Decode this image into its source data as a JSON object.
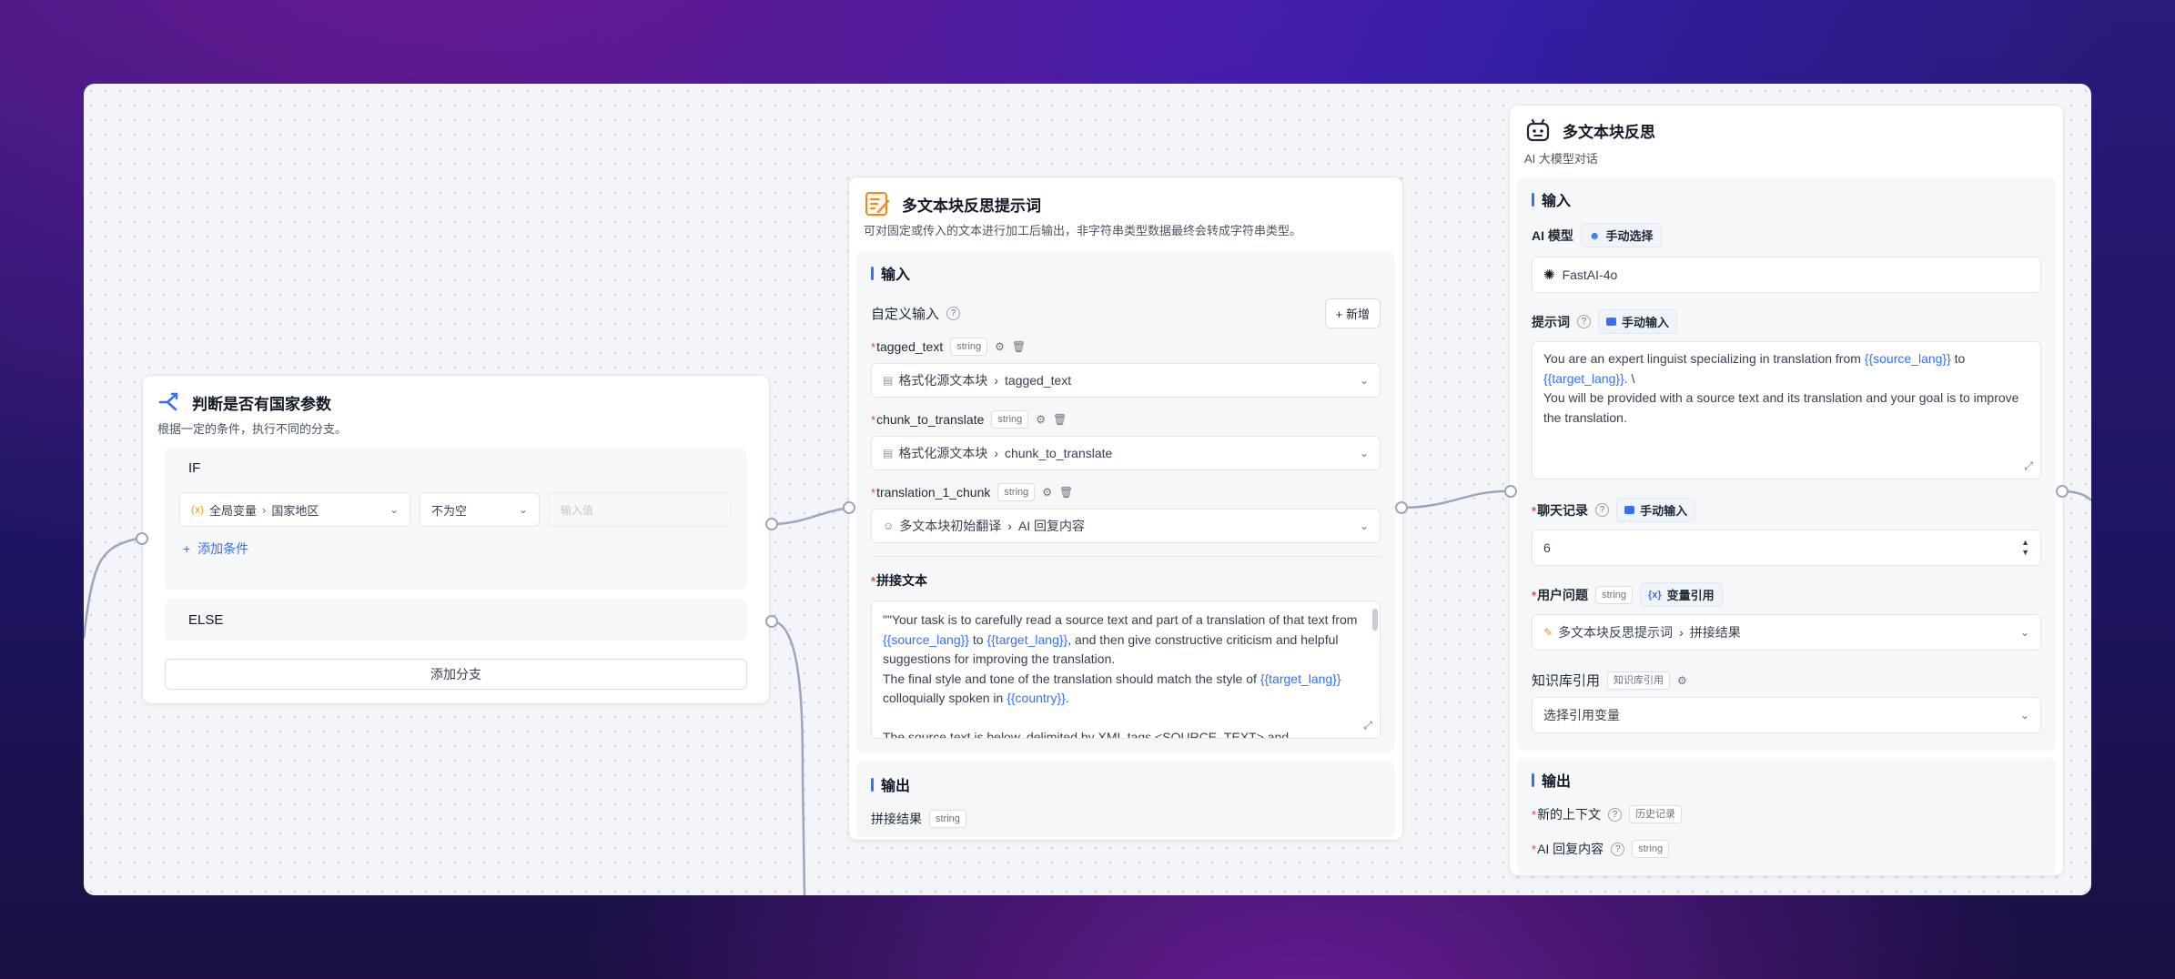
{
  "node_condition": {
    "title": "判断是否有国家参数",
    "description": "根据一定的条件，执行不同的分支。",
    "if_label": "IF",
    "variable_scope": "全局变量",
    "variable_name": "国家地区",
    "operator": "不为空",
    "value_placeholder": "输入值",
    "add_condition": "添加条件",
    "else_label": "ELSE",
    "add_branch": "添加分支"
  },
  "node_prompt": {
    "title": "多文本块反思提示词",
    "description": "可对固定或传入的文本进行加工后输出，非字符串类型数据最终会转成字符串类型。",
    "input_title": "输入",
    "custom_input_label": "自定义输入",
    "add_button": "+ 新增",
    "vars": [
      {
        "name": "tagged_text",
        "type": "string",
        "source": "格式化源文本块",
        "target": "tagged_text"
      },
      {
        "name": "chunk_to_translate",
        "type": "string",
        "source": "格式化源文本块",
        "target": "chunk_to_translate"
      },
      {
        "name": "translation_1_chunk",
        "type": "string",
        "source": "多文本块初始翻译",
        "target": "AI 回复内容"
      }
    ],
    "concat_label": "拼接文本",
    "concat_segments": [
      {
        "t": "\"\"Your task is to carefully read a source text and part of a translation of that text from "
      },
      {
        "t": "{{source_lang}}",
        "v": true
      },
      {
        "t": " to "
      },
      {
        "t": "{{target_lang}}",
        "v": true
      },
      {
        "t": ", and then give constructive criticism and helpful suggestions for improving the translation.\nThe final style and tone of the translation should match the style of "
      },
      {
        "t": "{{target_lang}}",
        "v": true
      },
      {
        "t": " colloquially spoken in "
      },
      {
        "t": "{{country}}",
        "v": true
      },
      {
        "t": ".\n\nThe source text is below, delimited by XML tags <SOURCE_TEXT> and"
      }
    ],
    "output_title": "输出",
    "output_name": "拼接结果",
    "output_type": "string"
  },
  "node_ai": {
    "title": "多文本块反思",
    "subtitle": "AI 大模型对话",
    "input_title": "输入",
    "model_label": "AI 模型",
    "model_mode": "手动选择",
    "model_value": "FastAI-4o",
    "prompt_label": "提示词",
    "prompt_mode": "手动输入",
    "prompt_segments": [
      {
        "t": "You are an expert linguist specializing in translation from "
      },
      {
        "t": "{{source_lang}}",
        "v": true
      },
      {
        "t": " to\n"
      },
      {
        "t": "{{target_lang}}",
        "v": true
      },
      {
        "t": ". \\\nYou will be provided with a source text and its translation and your goal is to improve the translation."
      }
    ],
    "history_label": "聊天记录",
    "history_mode": "手动输入",
    "history_value": "6",
    "question_label": "用户问题",
    "question_type": "string",
    "question_mode": "变量引用",
    "question_source": "多文本块反思提示词",
    "question_target": "拼接结果",
    "kb_label": "知识库引用",
    "kb_badge": "知识库引用",
    "kb_placeholder": "选择引用变量",
    "output_title": "输出",
    "out_context": "新的上下文",
    "out_context_type": "历史记录",
    "out_reply": "AI 回复内容",
    "out_reply_type": "string"
  }
}
